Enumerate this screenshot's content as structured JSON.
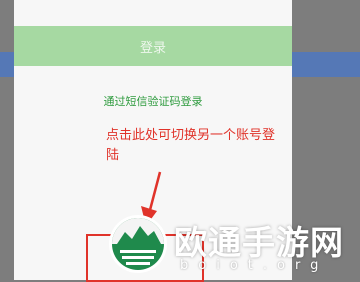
{
  "login": {
    "button_label": "登录",
    "sms_login_link": "通过短信验证码登录"
  },
  "annotation": {
    "text": "点击此处可切换另一个账号登陆"
  },
  "watermark": {
    "name": "欧通手游网",
    "domain": "boiot.org"
  },
  "colors": {
    "button_bg": "#a6d9a2",
    "link": "#2e9b3e",
    "annotation": "#e0332a",
    "panel_bg": "#f7f7f7",
    "overlay": "#7d7d7d"
  },
  "icons": [
    "arrow-icon",
    "watermark-logo-icon"
  ]
}
